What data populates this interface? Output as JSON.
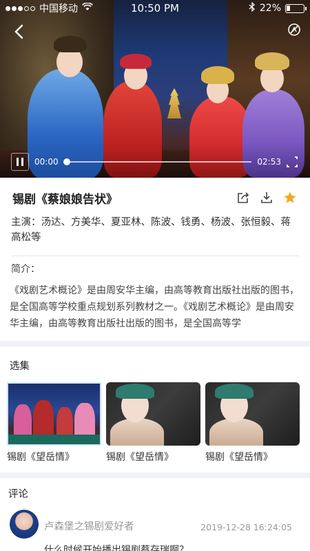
{
  "status_bar": {
    "carrier": "中国移动",
    "time": "10:50 PM",
    "battery": "22%",
    "battery_level": 0.22
  },
  "player": {
    "current_time": "00:00",
    "duration": "02:53",
    "progress": 0.0
  },
  "video": {
    "title": "锡剧《蔡娘娘告状》",
    "cast_label": "主演：",
    "cast": "汤达、方美华、夏亚林、陈波、钱勇、杨波、张恒毅、蒋高松等",
    "intro_label": "简介：",
    "intro": "《戏剧艺术概论》是由周安华主编，由高等教育出版社出版的图书，是全国高等学校重点规划系列教材之一。《戏剧艺术概论》是由周安华主编，由高等教育出版社出版的图书，是全国高等学"
  },
  "icons": {
    "back": "chevron-left-icon",
    "cast": "no-cast-icon",
    "share": "share-icon",
    "download": "download-icon",
    "favorite": "star-icon"
  },
  "colors": {
    "star": "#f5a623",
    "section_gap": "#f0f2f6"
  },
  "episodes": {
    "label": "选集",
    "items": [
      {
        "title": "锡剧《望岳情》"
      },
      {
        "title": "锡剧《望岳情》"
      },
      {
        "title": "锡剧《望岳情》"
      }
    ]
  },
  "comments": {
    "label": "评论",
    "items": [
      {
        "user": "卢森堡之锡剧爱好者",
        "time": "2019-12-28 16:24:05",
        "text": "什么时候开始播出锡剧蔡存瑞啊？"
      }
    ]
  }
}
